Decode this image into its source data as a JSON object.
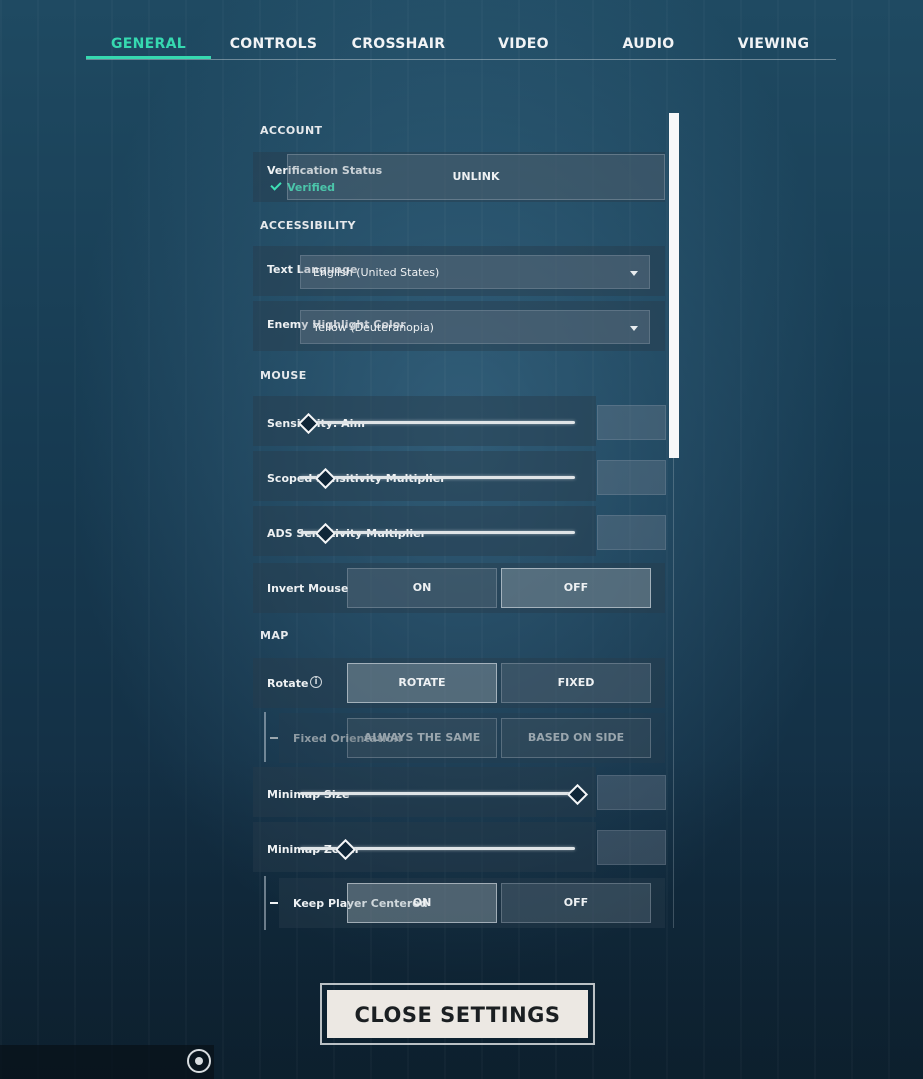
{
  "tabs": [
    {
      "label": "GENERAL",
      "active": true
    },
    {
      "label": "CONTROLS"
    },
    {
      "label": "CROSSHAIR"
    },
    {
      "label": "VIDEO"
    },
    {
      "label": "AUDIO"
    },
    {
      "label": "VIEWING"
    }
  ],
  "accent_color": "#36d9b0",
  "account": {
    "title": "ACCOUNT",
    "verification_label": "Verification Status",
    "verified_text": "Verified",
    "unlink_label": "UNLINK"
  },
  "accessibility": {
    "title": "ACCESSIBILITY",
    "text_language_label": "Text Language",
    "text_language_value": "English (United States)",
    "enemy_highlight_label": "Enemy Highlight Color",
    "enemy_highlight_value": "Yellow (Deuteranopia)"
  },
  "mouse": {
    "title": "MOUSE",
    "sensitivity_aim_label": "Sensitivity: Aim",
    "scoped_label": "Scoped Sensitivity Multiplier",
    "ads_label": "ADS Sensitivity Multiplier",
    "invert_label": "Invert Mouse",
    "invert_on": "ON",
    "invert_off": "OFF"
  },
  "map": {
    "title": "MAP",
    "rotate_label": "Rotate",
    "rotate_option": "ROTATE",
    "fixed_option": "FIXED",
    "fixed_orientation_label": "Fixed Orientation",
    "always_same": "ALWAYS THE SAME",
    "based_on_side": "BASED ON SIDE",
    "minimap_size_label": "Minimap Size",
    "minimap_zoom_label": "Minimap Zoom",
    "keep_centered_label": "Keep Player Centered",
    "keep_on": "ON",
    "keep_off": "OFF"
  },
  "close_label": "CLOSE SETTINGS"
}
